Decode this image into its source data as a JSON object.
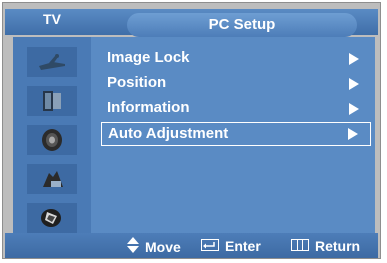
{
  "header": {
    "source_label": "TV",
    "menu_title": "PC Setup"
  },
  "sidebar": {
    "icons": [
      "antenna-icon",
      "picture-icon",
      "sound-icon",
      "channel-icon",
      "setup-icon"
    ]
  },
  "menu": {
    "items": [
      {
        "label": "Image Lock",
        "selected": false
      },
      {
        "label": "Position",
        "selected": false
      },
      {
        "label": "Information",
        "selected": false
      },
      {
        "label": "Auto Adjustment",
        "selected": true
      }
    ]
  },
  "footer": {
    "move_label": "Move",
    "enter_label": "Enter",
    "return_label": "Return"
  },
  "colors": {
    "panel": "#bdbdbd",
    "menu_bg": "#5a8bc4",
    "sidebar_bg": "#4a7ab5",
    "text": "#ffffff"
  }
}
